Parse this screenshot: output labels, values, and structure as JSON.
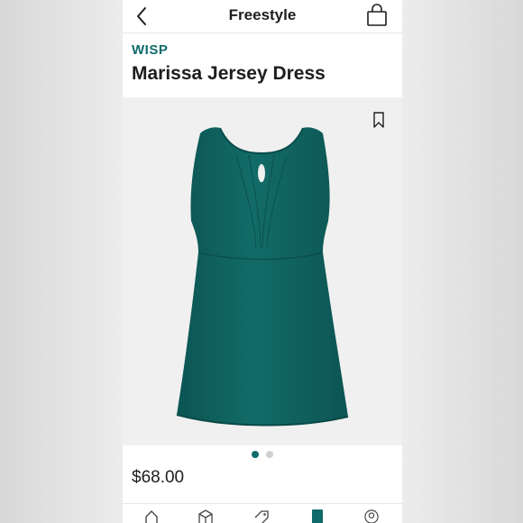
{
  "header": {
    "title": "Freestyle",
    "back_icon": "chevron-left-icon",
    "bag_icon": "shopping-bag-icon"
  },
  "product": {
    "brand": "WISP",
    "name": "Marissa Jersey Dress",
    "price": "$68.00",
    "dress_color": "#0f6361",
    "brand_color": "#0f6b6b"
  },
  "carousel": {
    "image_count": 2,
    "active_index": 0
  },
  "tabbar": {
    "items": [
      {
        "icon": "home-icon"
      },
      {
        "icon": "box-icon"
      },
      {
        "icon": "tag-icon"
      },
      {
        "icon": "freestyle-icon",
        "active": true
      },
      {
        "icon": "profile-icon"
      }
    ]
  }
}
